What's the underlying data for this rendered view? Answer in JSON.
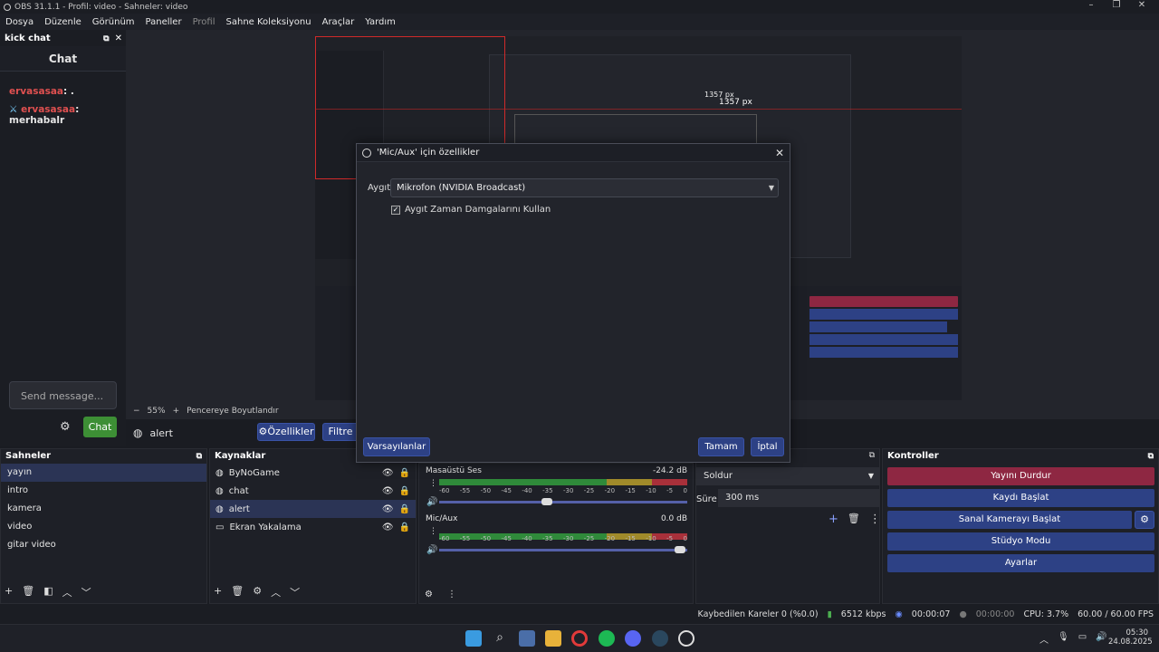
{
  "window": {
    "title": "OBS 31.1.1 - Profil: video - Sahneler: video"
  },
  "menu": [
    "Dosya",
    "Düzenle",
    "Görünüm",
    "Paneller",
    "Profil",
    "Sahne Koleksiyonu",
    "Araçlar",
    "Yardım"
  ],
  "chat": {
    "dock_title": "kick chat",
    "title": "Chat",
    "messages": [
      {
        "user": "ervasasaa",
        "text": ": ."
      },
      {
        "user": "ervasasaa",
        "text": ": merhabalr"
      }
    ],
    "send_placeholder": "Send message...",
    "send_button": "Chat"
  },
  "preview": {
    "zoom": "55%",
    "fit_label": "Pencereye Boyutlandır",
    "nested_measure_1": "1357 px",
    "nested_measure_2": "1357 px"
  },
  "source_bar": {
    "selected": "alert",
    "props_label": "Özellikler",
    "filters_label": "Filtre"
  },
  "dialog": {
    "title": "'Mic/Aux' için özellikler",
    "device_label": "Aygıt",
    "device_value": "Mikrofon (NVIDIA Broadcast)",
    "timestamp_label": "Aygıt Zaman Damgalarını Kullan",
    "timestamp_checked": true,
    "defaults_button": "Varsayılanlar",
    "ok_button": "Tamam",
    "cancel_button": "İptal"
  },
  "scenes": {
    "title": "Sahneler",
    "items": [
      "yayın",
      "intro",
      "kamera",
      "video",
      "gitar video"
    ],
    "selected": 0
  },
  "sources": {
    "title": "Kaynaklar",
    "items": [
      "ByNoGame",
      "chat",
      "alert",
      "Ekran Yakalama"
    ],
    "selected": 2
  },
  "mixer": {
    "channels": [
      {
        "name": "Masaüstü Ses",
        "db": "-24.2 dB"
      },
      {
        "name": "Mic/Aux",
        "db": "0.0 dB"
      }
    ],
    "ticks": [
      "-60",
      "-55",
      "-50",
      "-45",
      "-40",
      "-35",
      "-30",
      "-25",
      "-20",
      "-15",
      "-10",
      "-5",
      "0"
    ]
  },
  "transitions": {
    "type": "Soldur",
    "duration_label": "Süre",
    "duration_value": "300 ms"
  },
  "controls": {
    "title": "Kontroller",
    "buttons": [
      "Yayını Durdur",
      "Kaydı Başlat",
      "Sanal Kamerayı Başlat",
      "Stüdyo Modu",
      "Ayarlar"
    ]
  },
  "status": {
    "dropped": "Kaybedilen Kareler 0 (%0.0)",
    "bitrate": "6512 kbps",
    "stream_time": "00:00:07",
    "rec_time": "00:00:00",
    "cpu": "CPU: 3.7%",
    "fps": "60.00 / 60.00 FPS"
  },
  "taskbar": {
    "time": "05:30",
    "date": "24.08.2025"
  },
  "colors": {
    "accent": "#2d4185",
    "stop": "#8e2742",
    "chat_green": "#3d8f35",
    "username": "#e05050"
  }
}
